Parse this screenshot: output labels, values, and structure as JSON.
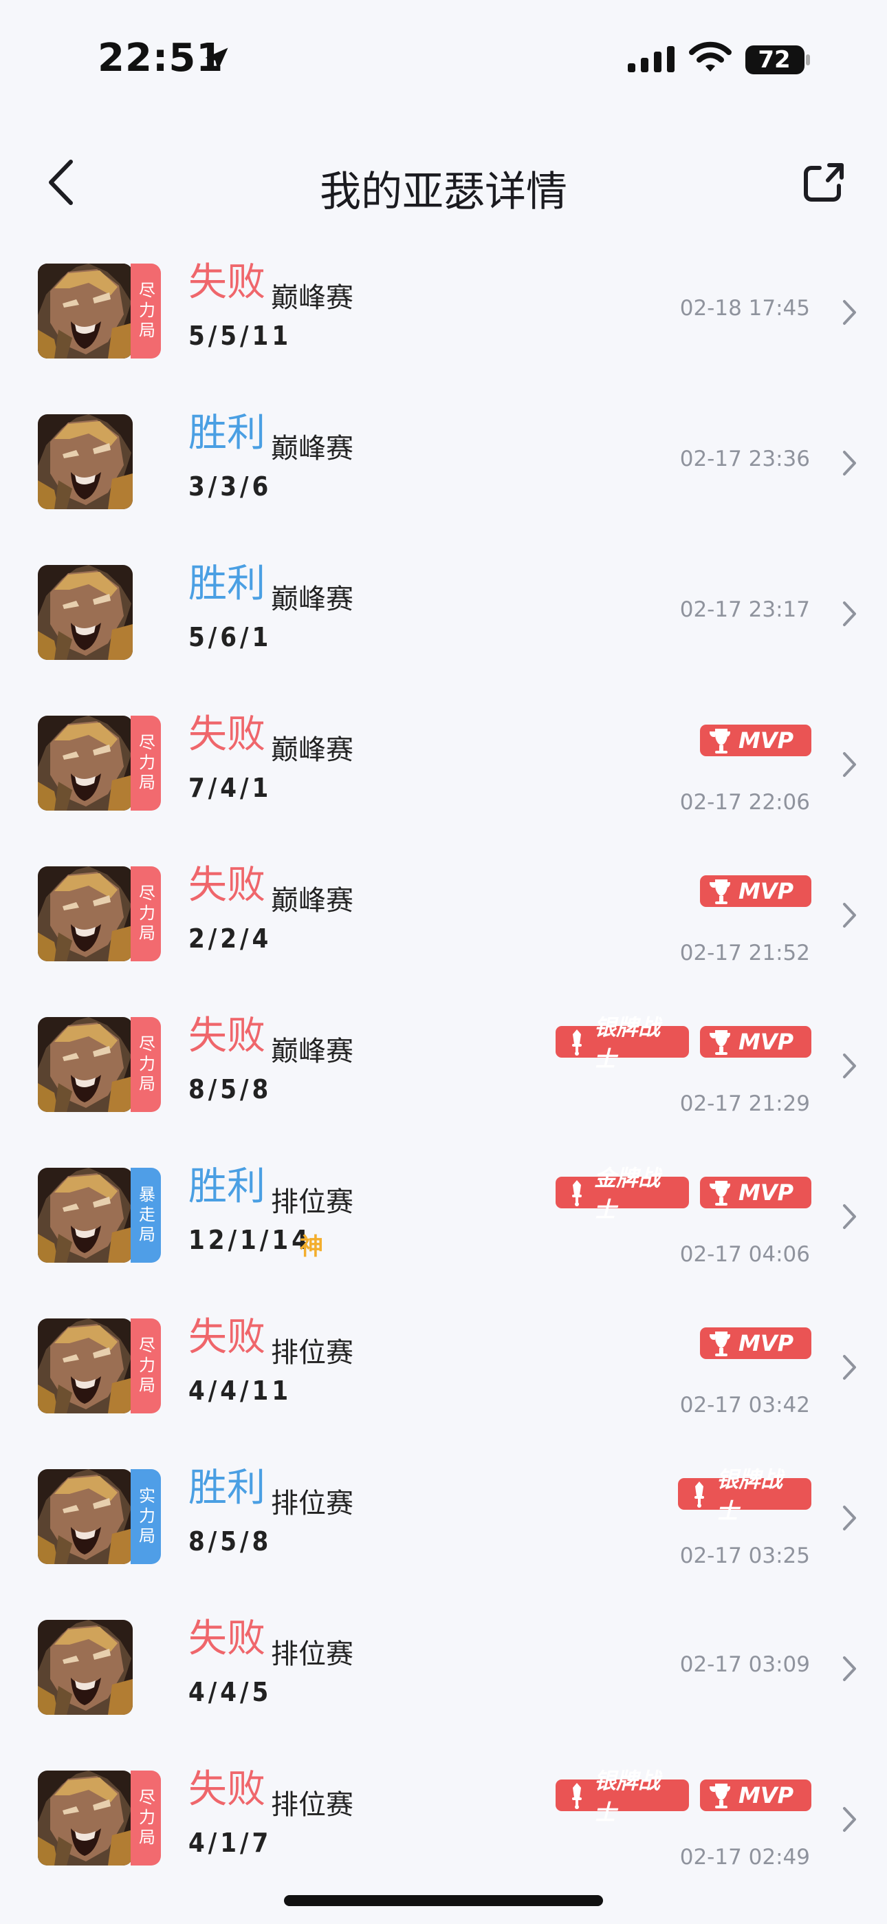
{
  "status": {
    "time": "22:51",
    "battery": "72"
  },
  "nav": {
    "title": "我的亚瑟详情"
  },
  "matches": [
    {
      "result": "失败",
      "mode": "巅峰赛",
      "kda": "5/5/11",
      "time": "02-18 17:45",
      "tag": "尽力局",
      "tag_color": "#f26a6f",
      "badges": [],
      "god": ""
    },
    {
      "result": "胜利",
      "mode": "巅峰赛",
      "kda": "3/3/6",
      "time": "02-17 23:36",
      "tag": "",
      "tag_color": "",
      "badges": [],
      "god": ""
    },
    {
      "result": "胜利",
      "mode": "巅峰赛",
      "kda": "5/6/1",
      "time": "02-17 23:17",
      "tag": "",
      "tag_color": "",
      "badges": [],
      "god": ""
    },
    {
      "result": "失败",
      "mode": "巅峰赛",
      "kda": "7/4/1",
      "time": "02-17 22:06",
      "tag": "尽力局",
      "tag_color": "#f26a6f",
      "badges": [
        "MVP"
      ],
      "god": ""
    },
    {
      "result": "失败",
      "mode": "巅峰赛",
      "kda": "2/2/4",
      "time": "02-17 21:52",
      "tag": "尽力局",
      "tag_color": "#f26a6f",
      "badges": [
        "MVP"
      ],
      "god": ""
    },
    {
      "result": "失败",
      "mode": "巅峰赛",
      "kda": "8/5/8",
      "time": "02-17 21:29",
      "tag": "尽力局",
      "tag_color": "#f26a6f",
      "badges": [
        "银牌战士",
        "MVP"
      ],
      "god": ""
    },
    {
      "result": "胜利",
      "mode": "排位赛",
      "kda": "12/1/14",
      "time": "02-17 04:06",
      "tag": "暴走局",
      "tag_color": "#4f9ee7",
      "badges": [
        "金牌战士",
        "MVP"
      ],
      "god": "神"
    },
    {
      "result": "失败",
      "mode": "排位赛",
      "kda": "4/4/11",
      "time": "02-17 03:42",
      "tag": "尽力局",
      "tag_color": "#f26a6f",
      "badges": [
        "MVP"
      ],
      "god": ""
    },
    {
      "result": "胜利",
      "mode": "排位赛",
      "kda": "8/5/8",
      "time": "02-17 03:25",
      "tag": "实力局",
      "tag_color": "#4f9ee7",
      "badges": [
        "银牌战士"
      ],
      "god": ""
    },
    {
      "result": "失败",
      "mode": "排位赛",
      "kda": "4/4/5",
      "time": "02-17 03:09",
      "tag": "",
      "tag_color": "",
      "badges": [],
      "god": ""
    },
    {
      "result": "失败",
      "mode": "排位赛",
      "kda": "4/1/7",
      "time": "02-17 02:49",
      "tag": "尽力局",
      "tag_color": "#f26a6f",
      "badges": [
        "银牌战士",
        "MVP"
      ],
      "god": ""
    }
  ]
}
